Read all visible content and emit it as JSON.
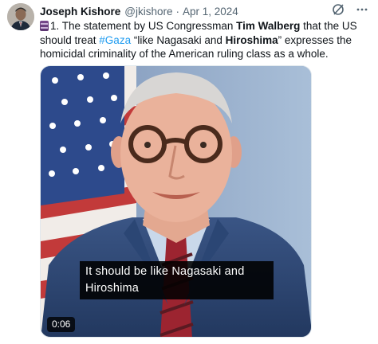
{
  "author": {
    "name": "Joseph Kishore",
    "handle": "@jkishore",
    "separator": "·",
    "date": "Apr 1, 2024"
  },
  "icons": {
    "header_left": "grok-icon",
    "header_right": "more-icon",
    "prefix": "scroll-emoji-icon"
  },
  "tweet": {
    "t1": "1. The statement by US Congressman ",
    "t2": "Tim Walberg",
    "t3": " that the US should treat ",
    "hashtag": "#Gaza",
    "t4": " “like Nagasaki and ",
    "t5": "Hiroshima",
    "t6": "” expresses the homicidal criminality of the American ruling class as a whole."
  },
  "video": {
    "caption_line1": "It should be like Nagasaki and",
    "caption_line2": "Hiroshima",
    "duration": "0:06"
  },
  "colors": {
    "link": "#1d9bf0",
    "text": "#0f1419",
    "secondary": "#536471"
  }
}
